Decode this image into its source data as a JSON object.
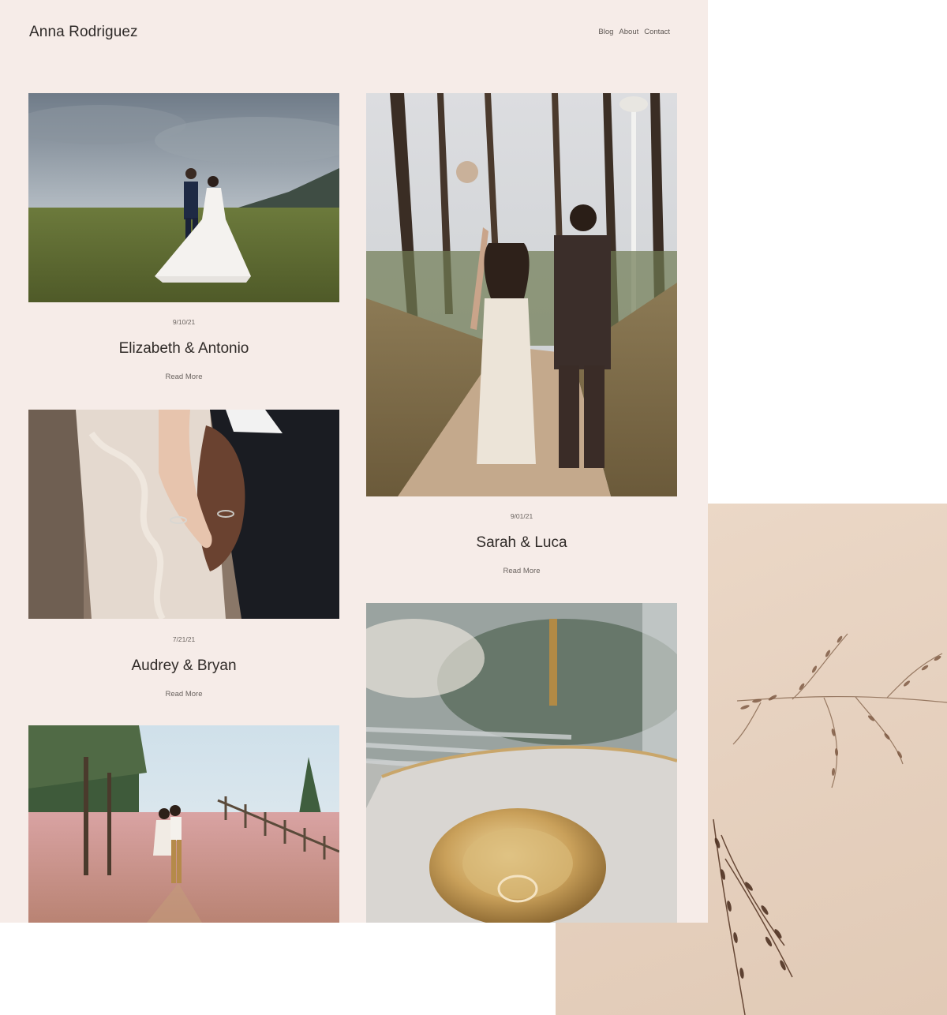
{
  "site": {
    "brand": "Anna Rodriguez",
    "nav": [
      "Blog",
      "About",
      "Contact"
    ]
  },
  "posts": [
    {
      "date": "9/10/21",
      "title": "Elizabeth & Antonio",
      "read_more": "Read More"
    },
    {
      "date": "9/01/21",
      "title": "Sarah & Luca",
      "read_more": "Read More"
    },
    {
      "date": "7/21/21",
      "title": "Audrey & Bryan",
      "read_more": "Read More"
    }
  ],
  "colors": {
    "page_background": "#f6ece8",
    "backdrop": "#e6d1bf",
    "text": "#2f2a27"
  }
}
